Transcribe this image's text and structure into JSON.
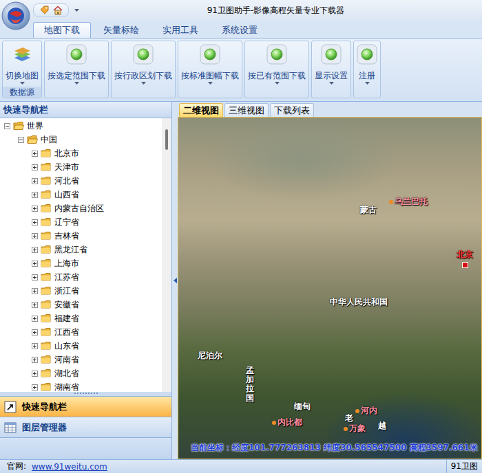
{
  "window": {
    "title": "91卫图助手-影像高程矢量专业下载器"
  },
  "ribbon_tabs": [
    {
      "label": "地图下载",
      "selected": true
    },
    {
      "label": "矢量标绘",
      "selected": false
    },
    {
      "label": "实用工具",
      "selected": false
    },
    {
      "label": "系统设置",
      "selected": false
    }
  ],
  "ribbon": {
    "data_source": {
      "button": "切换地图",
      "group": "数据源"
    },
    "buttons": [
      "按选定范围下载",
      "按行政区划下载",
      "按标准图幅下载",
      "按已有范围下载",
      "显示设置",
      "注册"
    ]
  },
  "sidebar": {
    "title": "快速导航栏",
    "tree": [
      {
        "label": "世界",
        "level": 0,
        "expanded": true
      },
      {
        "label": "中国",
        "level": 1,
        "expanded": true
      },
      {
        "label": "北京市",
        "level": 2,
        "expanded": false
      },
      {
        "label": "天津市",
        "level": 2,
        "expanded": false
      },
      {
        "label": "河北省",
        "level": 2,
        "expanded": false
      },
      {
        "label": "山西省",
        "level": 2,
        "expanded": false
      },
      {
        "label": "内蒙古自治区",
        "level": 2,
        "expanded": false
      },
      {
        "label": "辽宁省",
        "level": 2,
        "expanded": false
      },
      {
        "label": "吉林省",
        "level": 2,
        "expanded": false
      },
      {
        "label": "黑龙江省",
        "level": 2,
        "expanded": false
      },
      {
        "label": "上海市",
        "level": 2,
        "expanded": false
      },
      {
        "label": "江苏省",
        "level": 2,
        "expanded": false
      },
      {
        "label": "浙江省",
        "level": 2,
        "expanded": false
      },
      {
        "label": "安徽省",
        "level": 2,
        "expanded": false
      },
      {
        "label": "福建省",
        "level": 2,
        "expanded": false
      },
      {
        "label": "江西省",
        "level": 2,
        "expanded": false
      },
      {
        "label": "山东省",
        "level": 2,
        "expanded": false
      },
      {
        "label": "河南省",
        "level": 2,
        "expanded": false
      },
      {
        "label": "湖北省",
        "level": 2,
        "expanded": false
      },
      {
        "label": "湖南省",
        "level": 2,
        "expanded": false
      }
    ],
    "sections": [
      {
        "label": "快速导航栏",
        "selected": true
      },
      {
        "label": "图层管理器",
        "selected": false
      }
    ]
  },
  "view_tabs": [
    {
      "label": "二维视图",
      "selected": true
    },
    {
      "label": "三维视图",
      "selected": false
    },
    {
      "label": "下载列表",
      "selected": false
    }
  ],
  "map": {
    "labels": [
      {
        "text": "蒙古",
        "kind": "country"
      },
      {
        "text": "乌兰巴托",
        "kind": "city"
      },
      {
        "text": "北京",
        "kind": "capital"
      },
      {
        "text": "中华人民共和国",
        "kind": "country"
      },
      {
        "text": "尼泊尔",
        "kind": "country"
      },
      {
        "text": "孟加拉国",
        "kind": "country-vertical"
      },
      {
        "text": "缅甸",
        "kind": "country"
      },
      {
        "text": "内比都",
        "kind": "city"
      },
      {
        "text": "河内",
        "kind": "city"
      },
      {
        "text": "老",
        "kind": "country"
      },
      {
        "text": "万象",
        "kind": "city"
      },
      {
        "text": "越",
        "kind": "country"
      }
    ],
    "coordinates": "当前坐标：经度101.777263813 纬度30.565547500 高程3597.661米"
  },
  "status_bar": {
    "site_label": "官网:",
    "site_url": "www.91weitu.com",
    "right": "91卫图"
  }
}
